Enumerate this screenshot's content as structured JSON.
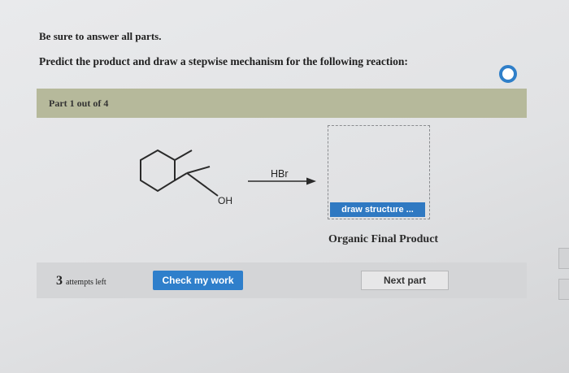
{
  "instructions": {
    "line1": "Be sure to answer all parts.",
    "line2": "Predict the product and draw a stepwise mechanism for the following reaction:"
  },
  "part": {
    "label": "Part 1 out of 4"
  },
  "reaction": {
    "substituent_label": "OH",
    "reagent": "HBr",
    "product_caption": "Organic Final Product"
  },
  "draw_button": {
    "label": "draw structure ..."
  },
  "footer": {
    "attempts_count": "3",
    "attempts_text": "attempts left",
    "check_label": "Check my work",
    "next_label": "Next part"
  },
  "icons": {
    "progress": "progress-ring-icon",
    "arrow": "reaction-arrow-icon"
  },
  "colors": {
    "accent_blue": "#2f7fcb",
    "part_bar": "#b6b99b",
    "background": "#e4e5e7"
  }
}
